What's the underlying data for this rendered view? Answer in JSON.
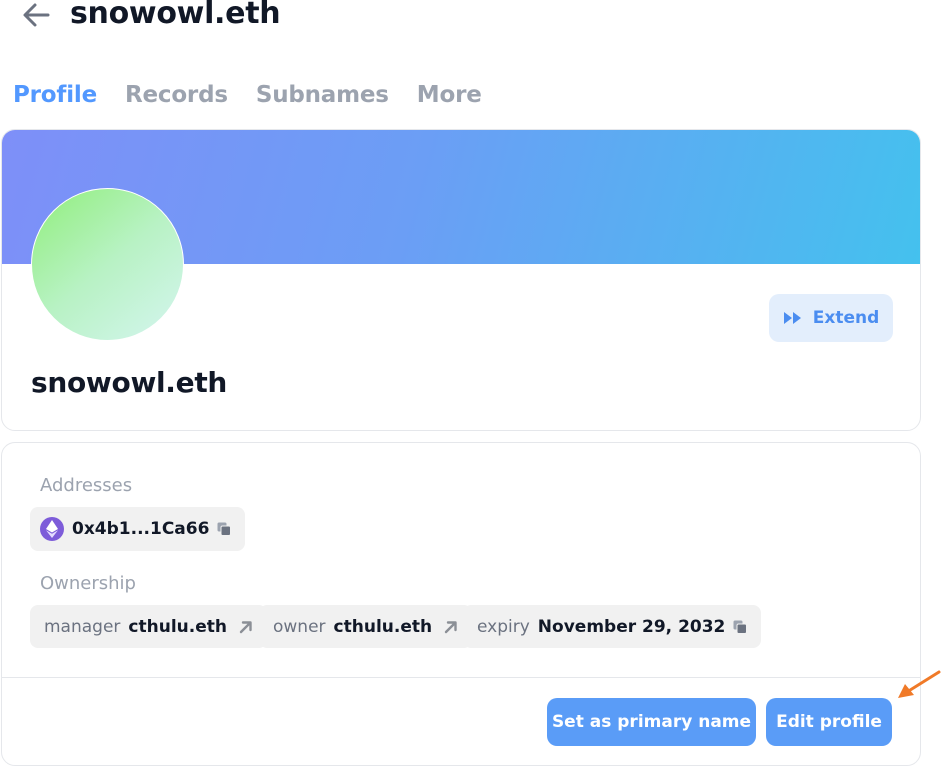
{
  "header": {
    "title": "snowowl.eth",
    "back_icon": "arrow-left-icon"
  },
  "tabs": [
    {
      "label": "Profile",
      "active": true
    },
    {
      "label": "Records",
      "active": false
    },
    {
      "label": "Subnames",
      "active": false
    },
    {
      "label": "More",
      "active": false
    }
  ],
  "profile": {
    "name": "snowowl.eth",
    "extend_label": "Extend",
    "extend_icon": "fast-forward-icon"
  },
  "addresses": {
    "label": "Addresses",
    "items": [
      {
        "value": "0x4b1...1Ca66",
        "chain_icon": "ethereum-icon"
      }
    ]
  },
  "ownership": {
    "label": "Ownership",
    "items": [
      {
        "key": "manager",
        "value": "cthulu.eth",
        "icon": "external-link-icon"
      },
      {
        "key": "owner",
        "value": "cthulu.eth",
        "icon": "external-link-icon"
      },
      {
        "key": "expiry",
        "value": "November 29, 2032",
        "icon": "copy-icon"
      }
    ]
  },
  "actions": {
    "set_primary_label": "Set as primary name",
    "edit_profile_label": "Edit profile"
  },
  "colors": {
    "accent": "#5298ff",
    "button": "#5a9cf7",
    "annotation": "#f07a28"
  }
}
